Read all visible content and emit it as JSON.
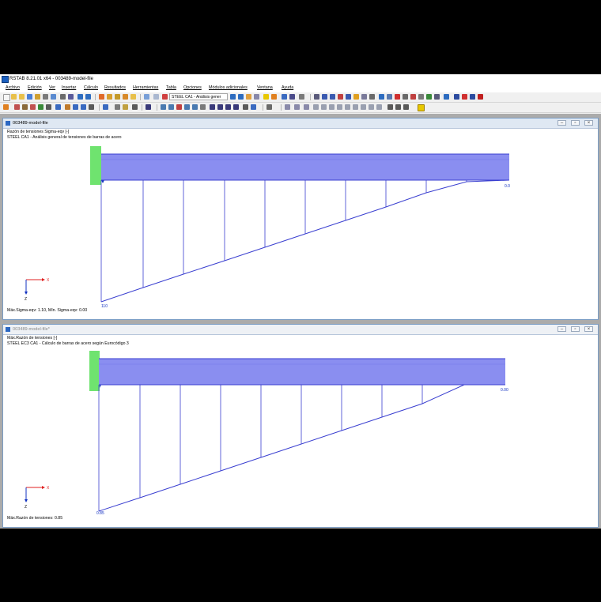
{
  "app": {
    "title": "RSTAB 8.21.01 x64 - 003489-model-file",
    "menu": [
      "Archivo",
      "Edición",
      "Ver",
      "Insertar",
      "Cálculo",
      "Resultados",
      "Herramientas",
      "Tabla",
      "Opciones",
      "Módulos adicionales",
      "Ventana",
      "Ayuda"
    ],
    "combo_module": "STEEL CA1 - Análisis gener",
    "accent": "#1b5fbf"
  },
  "window1": {
    "title": "003489-model-file",
    "info_line1": "Razón de tensiones Sigma-eqv [-]",
    "info_line2": "STEEL CA1 - Análisis general de tensiones de barras de acero",
    "footer": "Máx.Sigma-eqv: 1.10, Mín. Sigma-eqv: 0.00",
    "label_left": "110",
    "label_right": "0.0",
    "axis_x": "X",
    "axis_z": "Z"
  },
  "window2": {
    "title": "003489-model-file*",
    "info_line1": "Máx.Razón de tensiones [-]",
    "info_line2": "STEEL EC3 CA1 - Cálculo de barras de acero según Eurocódigo 3",
    "footer": "Máx.Razón de tensiones: 0.85",
    "label_left": "0.85",
    "label_right": "0.00",
    "axis_x": "X",
    "axis_z": "Z"
  },
  "colors": {
    "beam_fill": "#8a8ef0",
    "beam_edge": "#3a3fd0",
    "diagram": "#3a3fd0",
    "support": "#6fe36f",
    "axis_x": "#e02020",
    "axis_z": "#1030c0"
  }
}
